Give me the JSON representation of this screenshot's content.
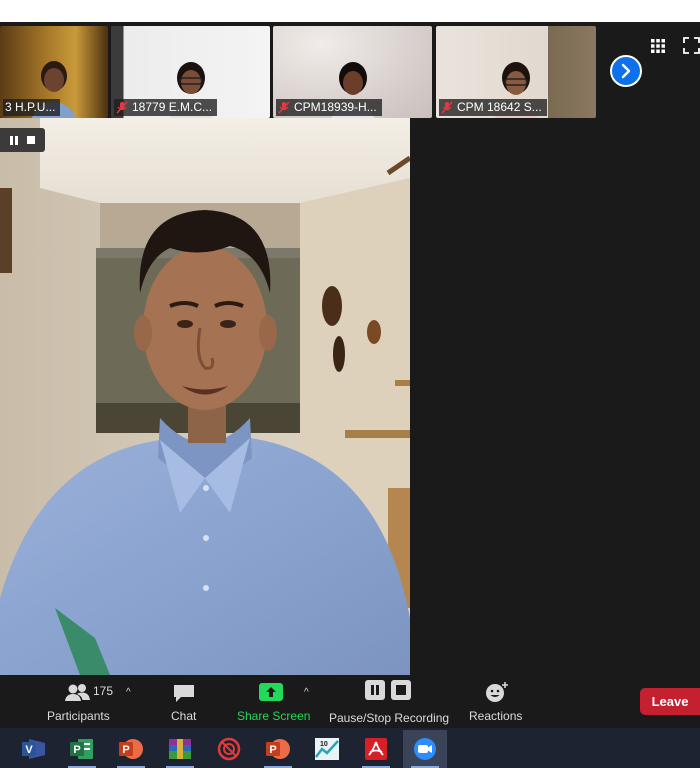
{
  "participants_strip": [
    {
      "name": "3 H.P.U...",
      "muted": false
    },
    {
      "name": "18779 E.M.C...",
      "muted": true
    },
    {
      "name": "CPM18939-H...",
      "muted": true
    },
    {
      "name": "CPM 18642 S...",
      "muted": true
    }
  ],
  "toolbar": {
    "participants_count": "175",
    "participants_label": "Participants",
    "chat_label": "Chat",
    "share_label": "Share Screen",
    "recording_label": "Pause/Stop Recording",
    "reactions_label": "Reactions",
    "leave_label": "Leave"
  },
  "colors": {
    "share_green": "#23d959",
    "leave_red": "#c4202f",
    "nav_blue": "#0e71eb"
  },
  "taskbar": [
    {
      "icon": "visio-icon",
      "label": "V",
      "color": "#2a5699"
    },
    {
      "icon": "project-icon",
      "label": "P",
      "color": "#217346"
    },
    {
      "icon": "powerpoint-icon",
      "label": "P",
      "color": "#d24726"
    },
    {
      "icon": "winrar-icon",
      "label": "",
      "color": "#7b2a8b"
    },
    {
      "icon": "target-app-icon",
      "label": "",
      "color": "#c4202f"
    },
    {
      "icon": "powerpoint-icon",
      "label": "P",
      "color": "#d24726"
    },
    {
      "icon": "chart-app-icon",
      "label": "10",
      "color": "#3aa9b8"
    },
    {
      "icon": "acrobat-icon",
      "label": "",
      "color": "#d81f26"
    },
    {
      "icon": "zoom-app-icon",
      "label": "",
      "color": "#2d8cff"
    }
  ]
}
